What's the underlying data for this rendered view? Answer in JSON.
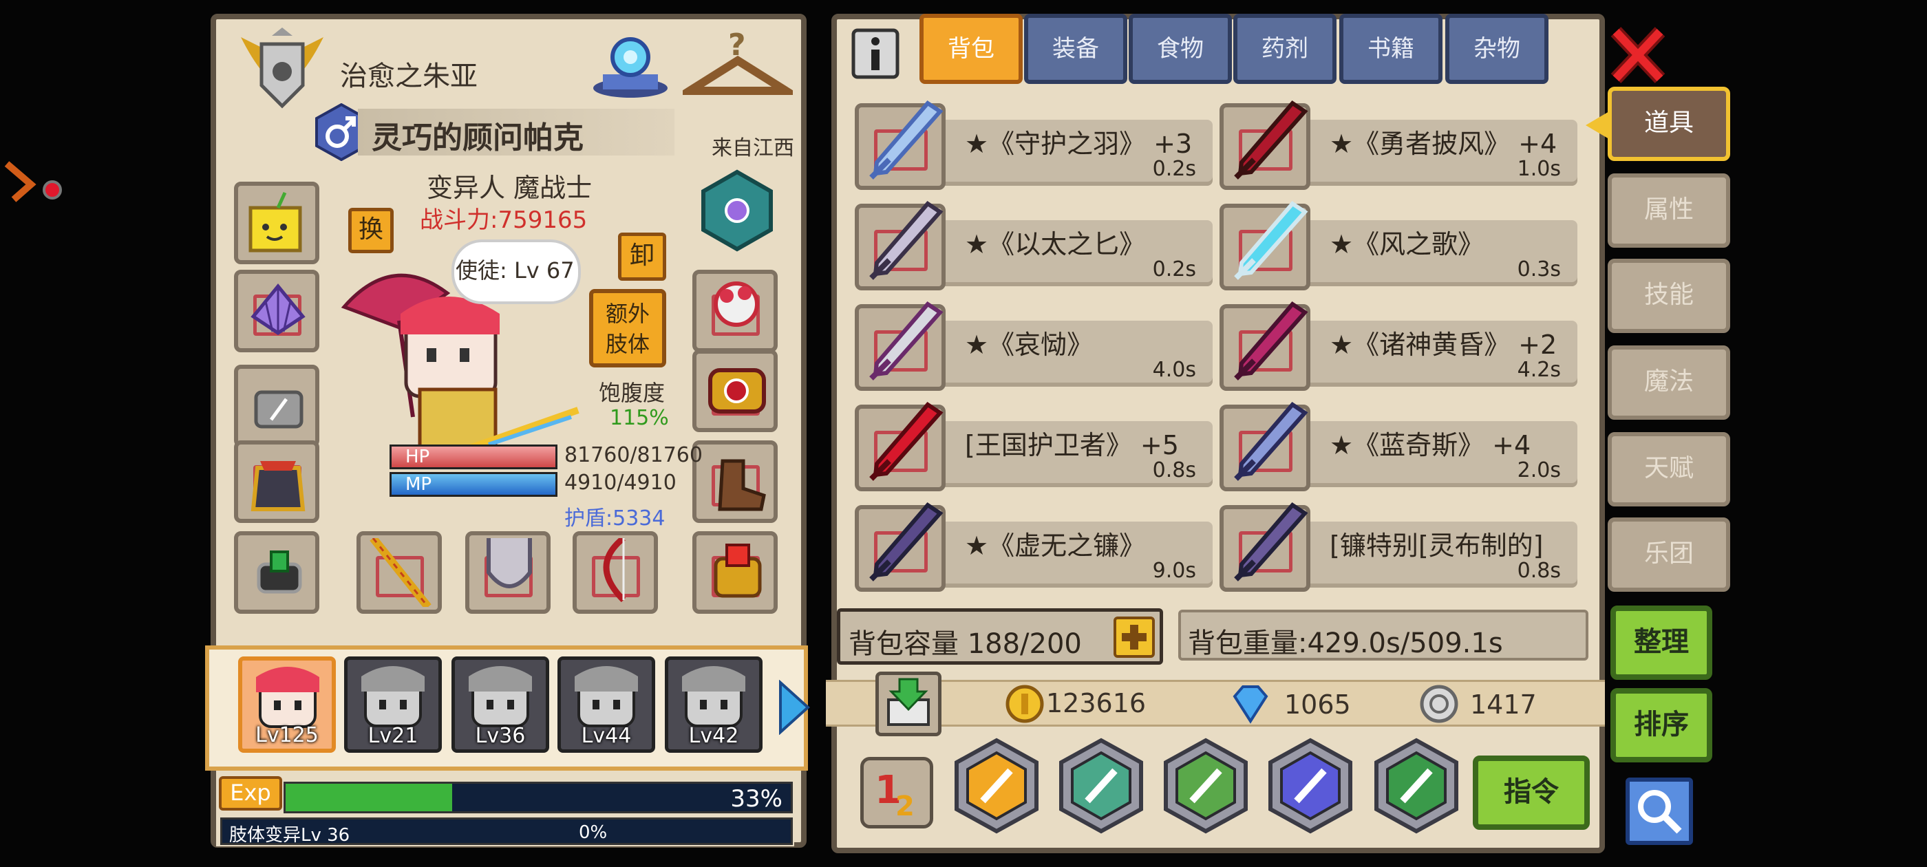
{
  "profile": {
    "player_name": "治愈之朱亚",
    "character_title": "灵巧的顾问帕克",
    "origin": "来自江西",
    "class": "变异人 魔战士",
    "combat_power": "战斗力:759165",
    "swap_label": "换",
    "unequip_label": "卸",
    "extra_limb_label": "额外\n肢体",
    "bubble_text": "使徒: Lv 67",
    "satiety_label": "饱腹度",
    "satiety_value": "115%",
    "hp_label": "HP",
    "hp_value": "81760/81760",
    "mp_label": "MP",
    "mp_value": "4910/4910",
    "shield": "护盾:5334"
  },
  "party": [
    {
      "lv": "Lv125",
      "active": true
    },
    {
      "lv": "Lv21",
      "active": false
    },
    {
      "lv": "Lv36",
      "active": false
    },
    {
      "lv": "Lv44",
      "active": false
    },
    {
      "lv": "Lv42",
      "active": false
    }
  ],
  "exp": {
    "label": "Exp",
    "percent_text": "33%",
    "fill": 0.33,
    "limb_label": "肢体变异Lv 36",
    "limb_percent": "0%"
  },
  "inventory_tabs": [
    "背包",
    "装备",
    "食物",
    "药剂",
    "书籍",
    "杂物"
  ],
  "items": [
    {
      "name": "★《守护之羽》 +3",
      "time": "0.2s"
    },
    {
      "name": "★《勇者披风》 +4",
      "time": "1.0s"
    },
    {
      "name": "★《以太之匕》",
      "time": "0.2s"
    },
    {
      "name": "★《风之歌》",
      "time": "0.3s"
    },
    {
      "name": "★《哀恸》",
      "time": "4.0s"
    },
    {
      "name": "★《诸神黄昏》 +2",
      "time": "4.2s"
    },
    {
      "name": "[王国护卫者》 +5",
      "time": "0.8s"
    },
    {
      "name": "★《蓝奇斯》 +4",
      "time": "2.0s"
    },
    {
      "name": "★《虚无之镰》",
      "time": "9.0s"
    },
    {
      "name": "[镰特别[灵布制的]",
      "time": "0.8s"
    }
  ],
  "bag": {
    "capacity": "背包容量 188/200",
    "weight": "背包重量:429.0s/509.1s"
  },
  "currency": {
    "gold": "123616",
    "diamond": "1065",
    "silver": "1417"
  },
  "side_tabs": [
    "道具",
    "属性",
    "技能",
    "魔法",
    "天赋",
    "乐团"
  ],
  "buttons": {
    "sort": "整理",
    "order": "排序",
    "command": "指令"
  },
  "colors": {
    "panel_bg": "#e8dcc4",
    "tab_active": "#f4a62c",
    "tab_inactive": "#5b6e9b",
    "green_button": "#8ccc3c",
    "combat_power_red": "#d0302c"
  }
}
